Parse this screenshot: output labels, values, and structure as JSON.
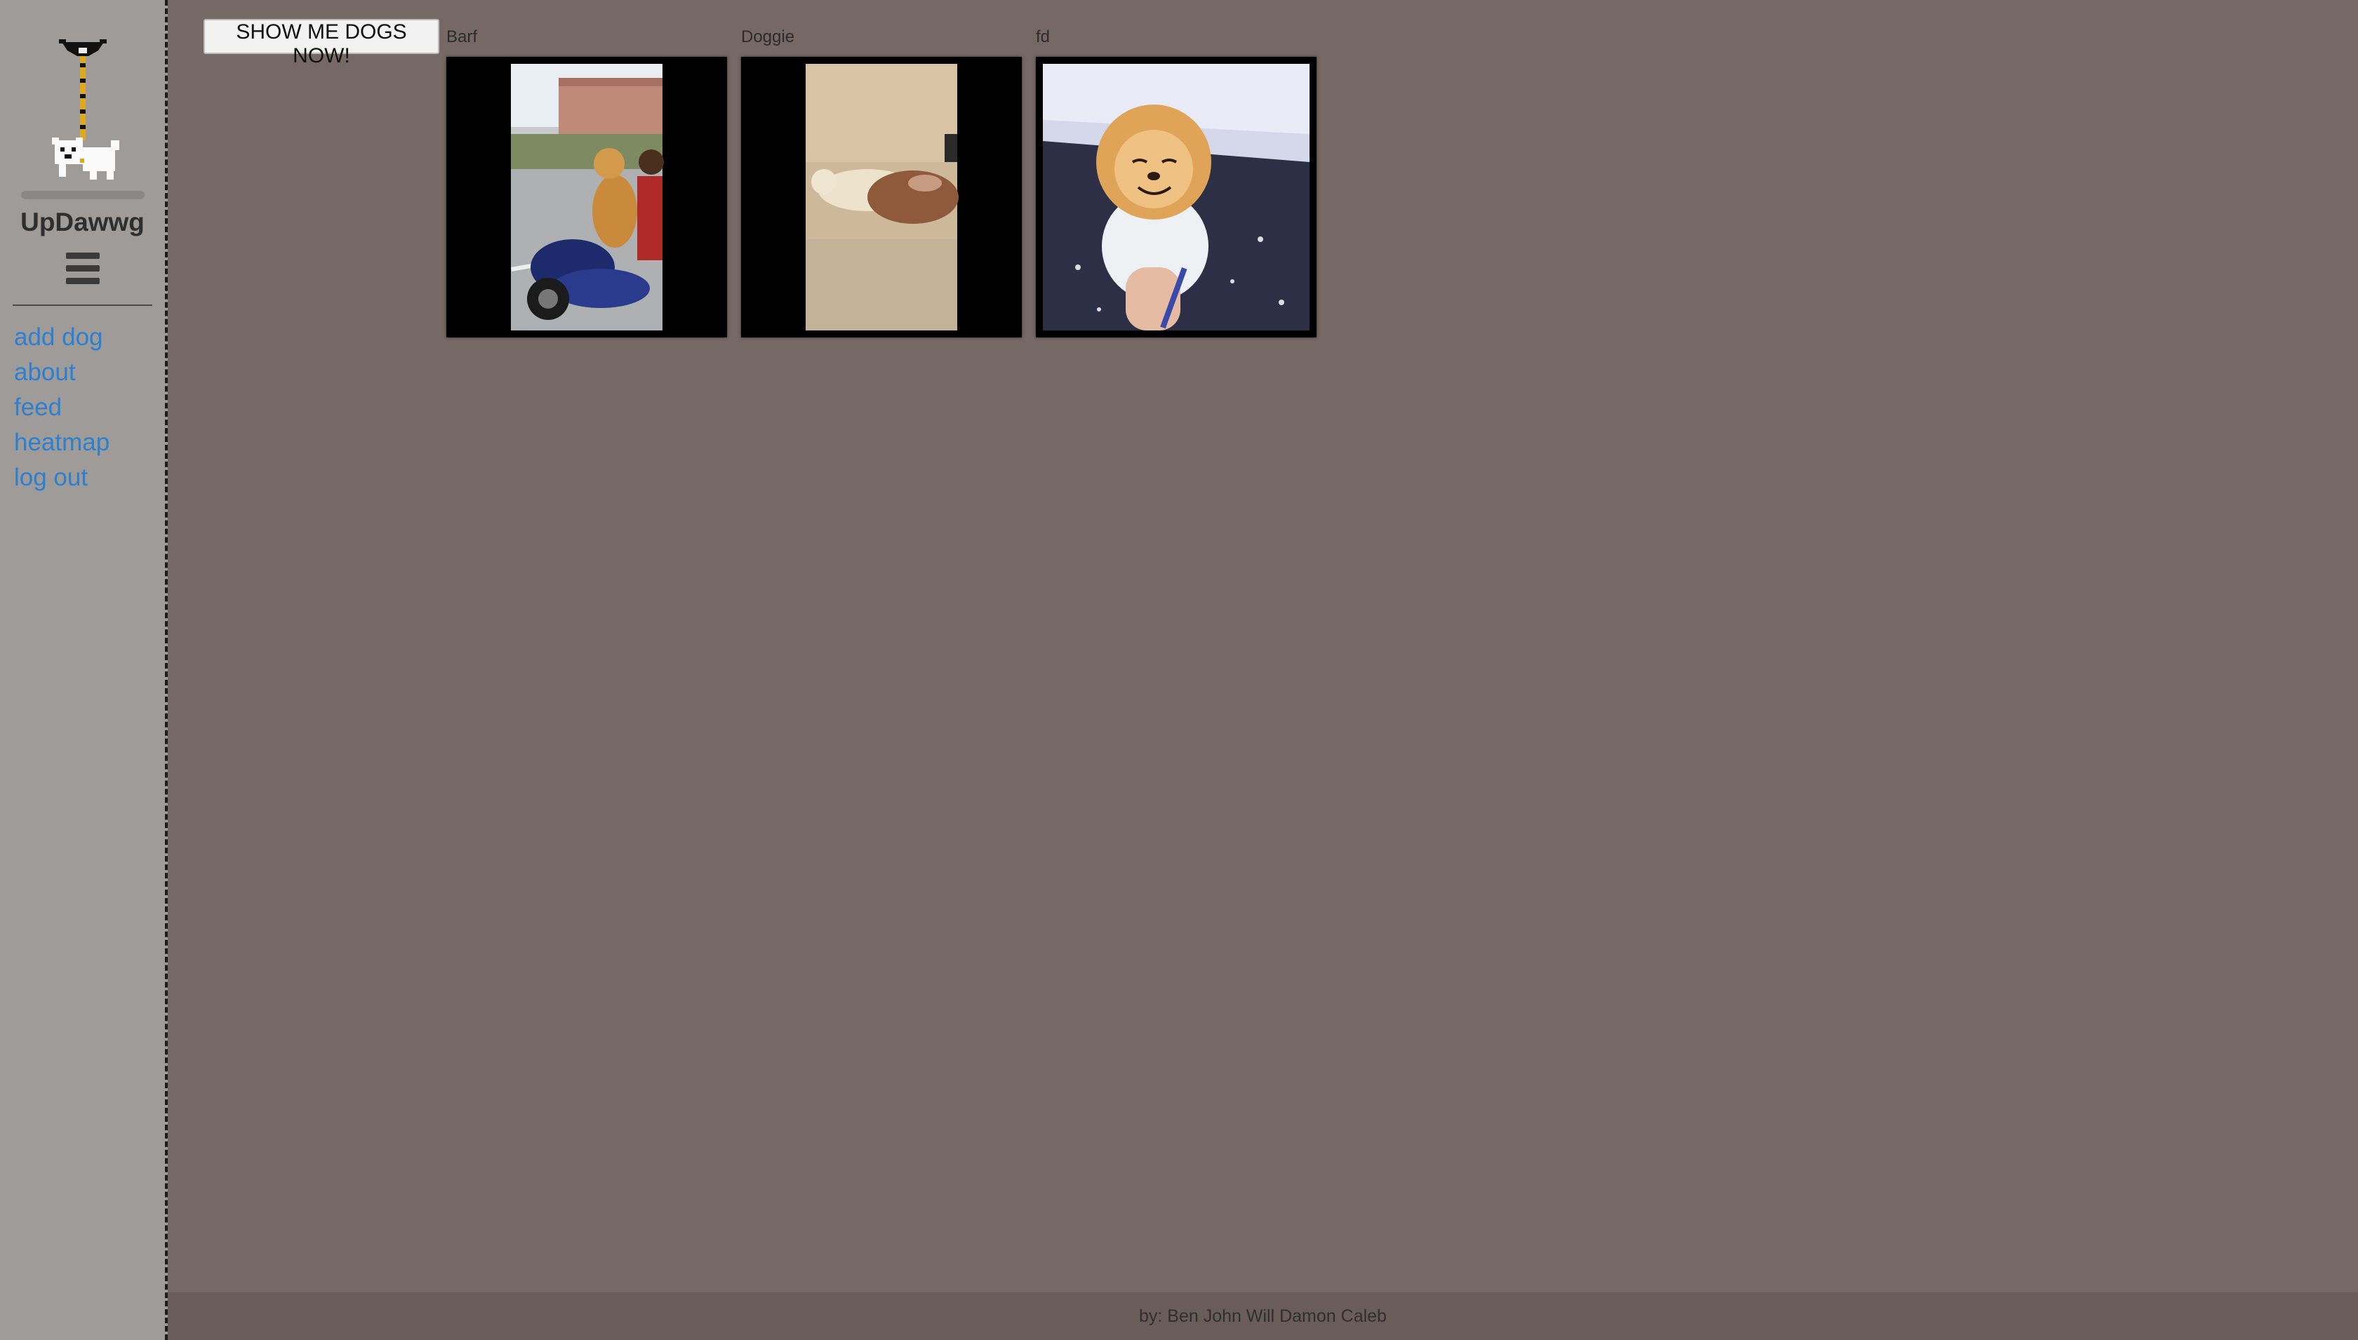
{
  "app": {
    "name": "UpDawwg"
  },
  "sidebar": {
    "logo_icon": "dog-on-leash-icon",
    "menu_icon": "hamburger-icon",
    "nav": [
      {
        "label": "add dog"
      },
      {
        "label": "about"
      },
      {
        "label": "feed"
      },
      {
        "label": "heatmap"
      },
      {
        "label": "log out"
      }
    ]
  },
  "main": {
    "show_button_label": "SHOW ME DOGS NOW!",
    "dogs": [
      {
        "name": "Barf",
        "thumbnail": "golden-retriever-riding-scooter"
      },
      {
        "name": "Doggie",
        "thumbnail": "dogs-lying-on-sand"
      },
      {
        "name": "fd",
        "thumbnail": "fluffy-pomeranian-smiling"
      }
    ]
  },
  "footer": {
    "credits": "by: Ben John Will Damon Caleb"
  },
  "colors": {
    "page_bg": "#766865",
    "sidebar_bg": "#9e9b99",
    "link": "#2d7fcf",
    "footer_bg": "#6a5d59"
  }
}
